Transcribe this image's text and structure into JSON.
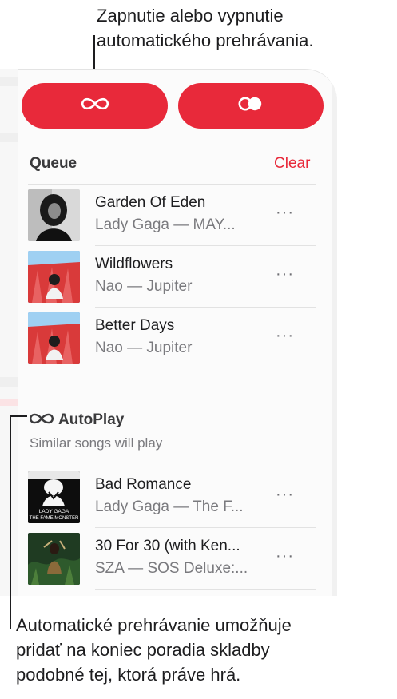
{
  "callouts": {
    "top": [
      "Zapnutie alebo vypnutie",
      "automatického prehrávania."
    ],
    "bottom": [
      "Automatické prehrávanie umožňuje",
      "pridať na koniec poradia skladby",
      "podobné tej, ktorá práve hrá."
    ]
  },
  "buttons": {
    "autoplay_icon": "infinity-icon",
    "repeat_icon": "repeat-toggle-icon"
  },
  "queue": {
    "title": "Queue",
    "clear_label": "Clear",
    "items": [
      {
        "title": "Garden Of Eden",
        "subtitle": "Lady Gaga — MAY...",
        "more": "···"
      },
      {
        "title": "Wildflowers",
        "subtitle": "Nao — Jupiter",
        "more": "···"
      },
      {
        "title": "Better Days",
        "subtitle": "Nao — Jupiter",
        "more": "···"
      }
    ]
  },
  "autoplay": {
    "title": "AutoPlay",
    "subtitle": "Similar songs will play",
    "items": [
      {
        "title": "Bad Romance",
        "subtitle": "Lady Gaga — The F...",
        "more": "···",
        "art_text": [
          "LADY GAGA",
          "THE FAME MONSTER"
        ]
      },
      {
        "title": "30 For 30 (with Ken...",
        "subtitle": "SZA — SOS Deluxe:...",
        "more": "···"
      }
    ]
  },
  "colors": {
    "accent": "#e8293a",
    "text": "#1d1d1f",
    "secondary": "#7a7a7e"
  }
}
